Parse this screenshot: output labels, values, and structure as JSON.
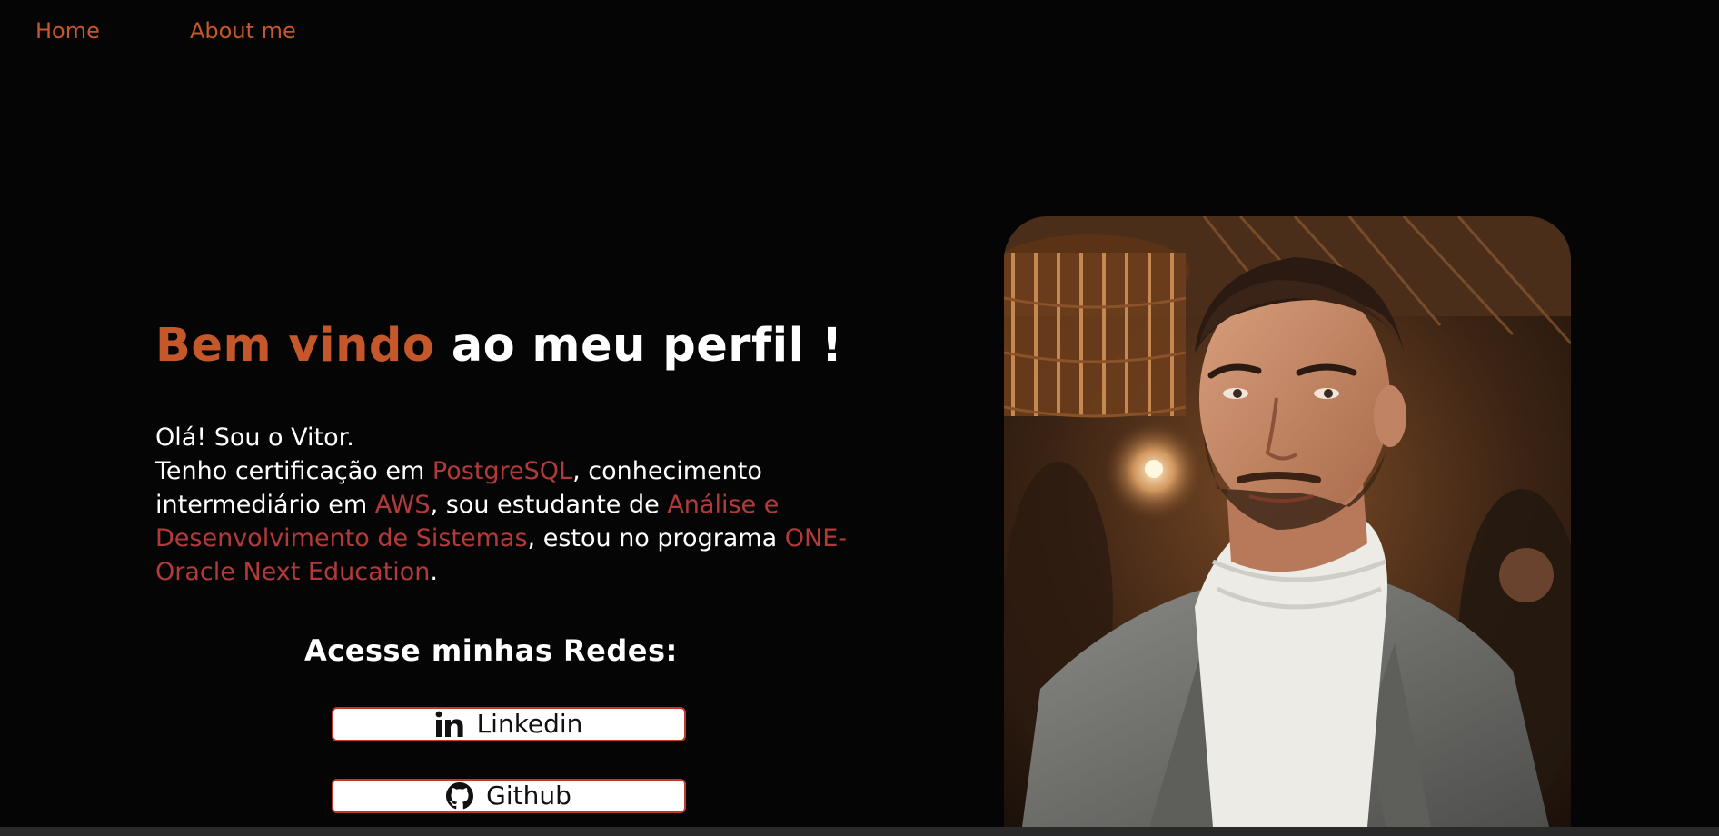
{
  "nav": {
    "home": "Home",
    "about": "About me"
  },
  "hero": {
    "headline_accent": "Bem vindo",
    "headline_rest": "ao meu perfil !",
    "greeting": "Olá! Sou o Vitor.",
    "intro_1": "Tenho certificação em ",
    "hl_postgres": "PostgreSQL",
    "intro_2": ", conhecimento intermediário em ",
    "hl_aws": "AWS",
    "intro_3": ", sou estudante de ",
    "hl_ads": "Análise e Desenvolvimento de Sistemas",
    "intro_4": ", estou no programa ",
    "hl_one": "ONE-Oracle Next Education",
    "intro_5": "."
  },
  "socials": {
    "title": "Acesse minhas Redes:",
    "linkedin_label": "Linkedin",
    "github_label": "Github",
    "linkedin_icon": "linkedin-icon",
    "github_icon": "github-icon"
  },
  "colors": {
    "background": "#050505",
    "accent_orange": "#c4582a",
    "highlight_red": "#b23a3a",
    "button_border": "#c0392b"
  }
}
